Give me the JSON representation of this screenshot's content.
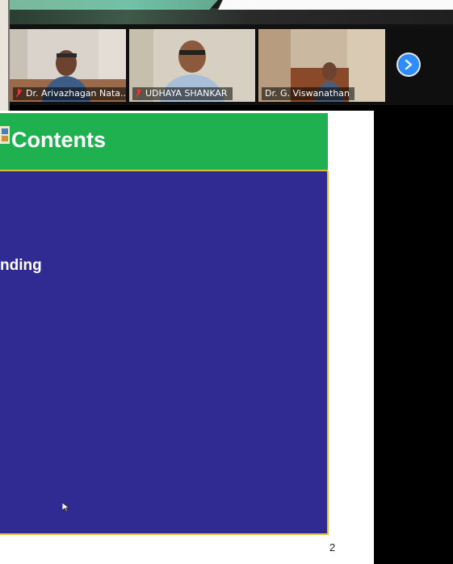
{
  "participants": [
    {
      "name": "Dr. Arivazhagan Nata...",
      "muted": true
    },
    {
      "name": "UDHAYA SHANKAR",
      "muted": true
    },
    {
      "name": "Dr. G. Viswanathan",
      "muted": false
    }
  ],
  "slide": {
    "title": "Contents",
    "body_text": "nding",
    "page_number": "2"
  },
  "colors": {
    "slide_title_bg": "#1fb150",
    "slide_body_bg": "#2f2b92",
    "slide_border": "#d8c23a",
    "next_button": "#2d8cff"
  }
}
